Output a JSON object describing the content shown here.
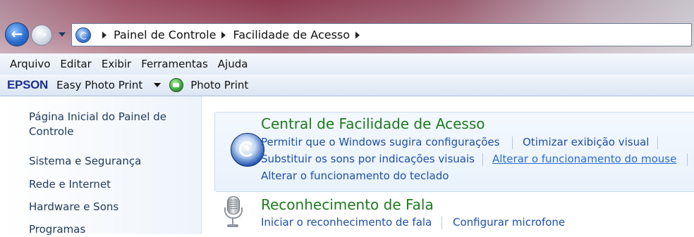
{
  "navigation": {
    "back_glyph": "←",
    "forward_glyph": "→"
  },
  "address_bar": {
    "breadcrumbs": [
      "Painel de Controle",
      "Facilidade de Acesso"
    ]
  },
  "menu": {
    "items": [
      "Arquivo",
      "Editar",
      "Exibir",
      "Ferramentas",
      "Ajuda"
    ]
  },
  "toolbar": {
    "brand": "EPSON",
    "easy_photo_print": "Easy Photo Print",
    "photo_print": "Photo Print"
  },
  "sidebar": {
    "items": [
      "Página Inicial do Painel de",
      "Controle",
      "Sistema e Segurança",
      "Rede e Internet",
      "Hardware e Sons",
      "Programas"
    ]
  },
  "sections": {
    "ease_of_access": {
      "title": "Central de Facilidade de Acesso",
      "icon": "ease-of-access-icon",
      "tasks": [
        "Permitir que o Windows sugira configurações",
        "Otimizar exibição visual",
        "Substituir os sons por indicações visuais",
        "Alterar o funcionamento do mouse",
        "Alterar o funcionamento do teclado"
      ]
    },
    "speech": {
      "title": "Reconhecimento de Fala",
      "icon": "microphone-icon",
      "tasks": [
        "Iniciar o reconhecimento de fala",
        "Configurar microfone"
      ]
    }
  },
  "colors": {
    "link": "#1c4fa8",
    "category_title": "#1e7a1e",
    "titlebar_accent": "#8e3c52"
  }
}
